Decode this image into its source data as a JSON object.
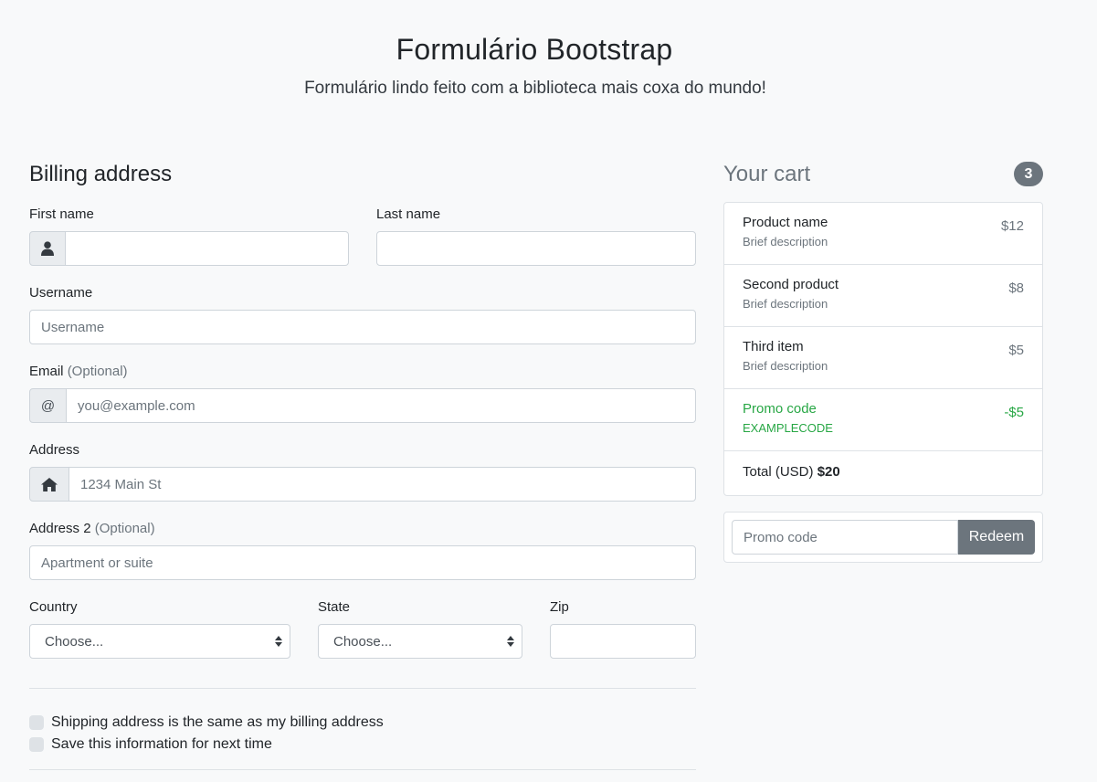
{
  "header": {
    "title": "Formulário Bootstrap",
    "subtitle": "Formulário lindo feito com a biblioteca mais coxa do mundo!"
  },
  "billing": {
    "heading": "Billing address",
    "first_name_label": "First name",
    "first_name_value": "",
    "last_name_label": "Last name",
    "last_name_value": "",
    "username_label": "Username",
    "username_placeholder": "Username",
    "email_label": "Email",
    "email_optional": "(Optional)",
    "email_addon": "@",
    "email_placeholder": "you@example.com",
    "address_label": "Address",
    "address_placeholder": "1234 Main St",
    "address2_label": "Address 2",
    "address2_optional": "(Optional)",
    "address2_placeholder": "Apartment or suite",
    "country_label": "Country",
    "country_selected": "Choose...",
    "state_label": "State",
    "state_selected": "Choose...",
    "zip_label": "Zip",
    "zip_value": "",
    "same_address_label": "Shipping address is the same as my billing address",
    "save_info_label": "Save this information for next time"
  },
  "cart": {
    "heading": "Your cart",
    "count": "3",
    "items": [
      {
        "name": "Product name",
        "desc": "Brief description",
        "price": "$12"
      },
      {
        "name": "Second product",
        "desc": "Brief description",
        "price": "$8"
      },
      {
        "name": "Third item",
        "desc": "Brief description",
        "price": "$5"
      }
    ],
    "promo": {
      "name": "Promo code",
      "code": "EXAMPLECODE",
      "amount": "-$5"
    },
    "total_label": "Total (USD)",
    "total_value": "$20",
    "promo_placeholder": "Promo code",
    "redeem_label": "Redeem"
  },
  "colors": {
    "background": "#f8f9fa",
    "success": "#28a745",
    "secondary": "#6c757d"
  },
  "icons": {
    "first_name_addon": "user-icon",
    "address_addon": "home-icon"
  }
}
